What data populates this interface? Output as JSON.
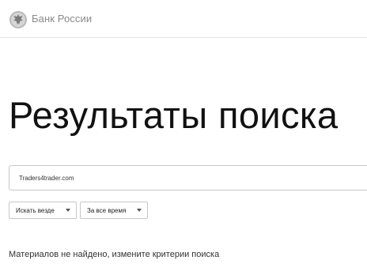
{
  "header": {
    "brand": "Банк России",
    "logo_icon": "bank-of-russia-eagle-icon"
  },
  "main": {
    "title": "Результаты поиска",
    "search": {
      "value": "Traders4trader.com"
    },
    "filters": [
      {
        "label": "Искать везде"
      },
      {
        "label": "За все время"
      }
    ],
    "message": "Материалов не найдено, измените критерии поиска"
  },
  "colors": {
    "text": "#111111",
    "muted": "#8a8a8a",
    "border": "#c8c8c8"
  }
}
